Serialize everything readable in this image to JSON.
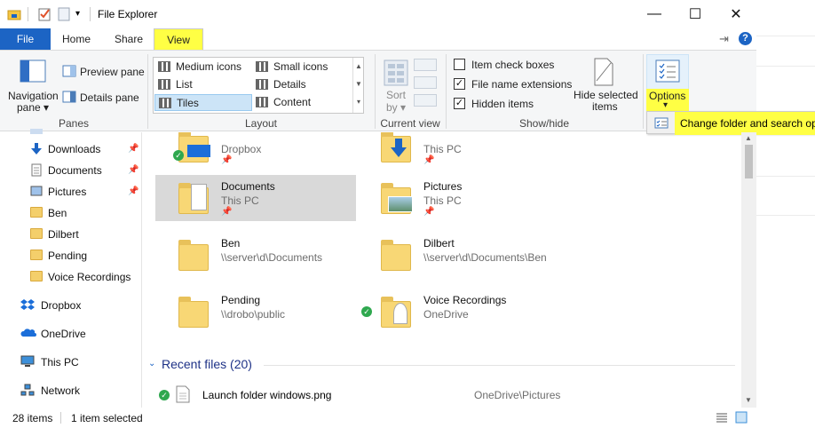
{
  "window": {
    "title": "File Explorer"
  },
  "window_controls": {
    "minimize": "—",
    "maximize": "☐",
    "close": "✕"
  },
  "tabs": [
    "File",
    "Home",
    "Share",
    "View"
  ],
  "help_icon": "?",
  "ribbon": {
    "panes": {
      "navigation_pane": "Navigation",
      "navigation_pane_2": "pane ▾",
      "preview_pane": "Preview pane",
      "details_pane": "Details pane",
      "group": "Panes"
    },
    "layout": {
      "items": [
        "Medium icons",
        "Small icons",
        "List",
        "Details",
        "Tiles",
        "Content"
      ],
      "group": "Layout"
    },
    "current_view": {
      "sort_by_1": "Sort",
      "sort_by_2": "by ▾",
      "group": "Current view"
    },
    "show_hide": {
      "item_check_boxes": "Item check boxes",
      "file_name_extensions": "File name extensions",
      "hidden_items": "Hidden items",
      "hide_selected_1": "Hide selected",
      "hide_selected_2": "items",
      "group": "Show/hide"
    },
    "options": {
      "label": "Options",
      "arrow": "▾"
    }
  },
  "flyout": {
    "text": "Change folder and search options"
  },
  "nav": {
    "items": [
      {
        "label": "Downloads"
      },
      {
        "label": "Documents"
      },
      {
        "label": "Pictures"
      },
      {
        "label": "Ben"
      },
      {
        "label": "Dilbert"
      },
      {
        "label": "Pending"
      },
      {
        "label": "Voice Recordings"
      },
      {
        "label": "Dropbox"
      },
      {
        "label": "OneDrive"
      },
      {
        "label": "This PC"
      },
      {
        "label": "Network"
      }
    ]
  },
  "tiles": [
    {
      "name": "",
      "sub": "Dropbox"
    },
    {
      "name": "",
      "sub": "This PC"
    },
    {
      "name": "Documents",
      "sub": "This PC"
    },
    {
      "name": "Pictures",
      "sub": "This PC"
    },
    {
      "name": "Ben",
      "sub": "\\\\server\\d\\Documents"
    },
    {
      "name": "Dilbert",
      "sub": "\\\\server\\d\\Documents\\Ben"
    },
    {
      "name": "Pending",
      "sub": "\\\\drobo\\public"
    },
    {
      "name": "Voice Recordings",
      "sub": "OneDrive"
    }
  ],
  "recent": {
    "header": "Recent files (20)",
    "files": [
      {
        "name": "Launch folder windows.png",
        "location": "OneDrive\\Pictures"
      }
    ]
  },
  "status": {
    "items": "28 items",
    "selected": "1 item selected"
  },
  "colors": {
    "accent": "#1c64c4",
    "highlight": "#ffff44",
    "selection": "#d9d9d9"
  }
}
